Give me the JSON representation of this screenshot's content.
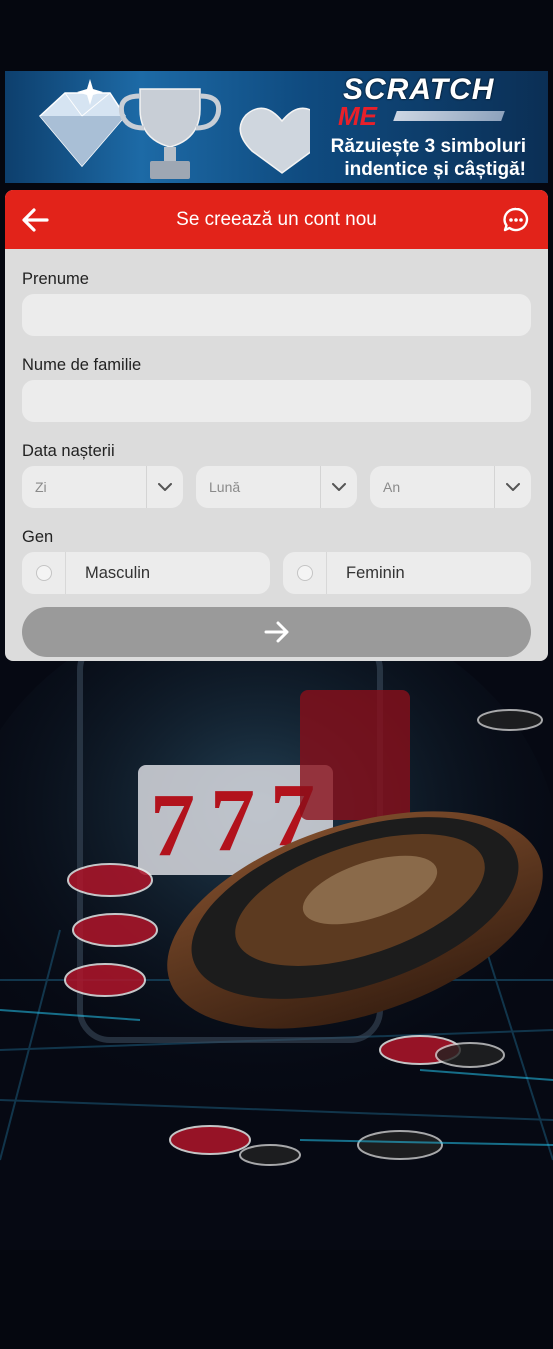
{
  "banner": {
    "logo_line1": "SCRATCH",
    "logo_line2": "ME",
    "tagline_line1": "Răzuiește 3 simboluri",
    "tagline_line2": "indentice și câștigă!"
  },
  "form": {
    "title": "Se creează un cont nou",
    "first_name_label": "Prenume",
    "first_name_value": "",
    "last_name_label": "Nume de familie",
    "last_name_value": "",
    "birthdate_label": "Data nașterii",
    "day_placeholder": "Zi",
    "month_placeholder": "Lună",
    "year_placeholder": "An",
    "gender_label": "Gen",
    "gender_male": "Masculin",
    "gender_female": "Feminin"
  },
  "icons": {
    "back": "arrow-left-icon",
    "chat": "chat-bubble-icon",
    "submit": "arrow-right-icon",
    "dropdown": "chevron-down-icon"
  },
  "colors": {
    "header_red": "#e2231a",
    "card_bg": "#dcdcdc",
    "input_bg": "#ececec",
    "submit_disabled": "#9a9a9a"
  }
}
